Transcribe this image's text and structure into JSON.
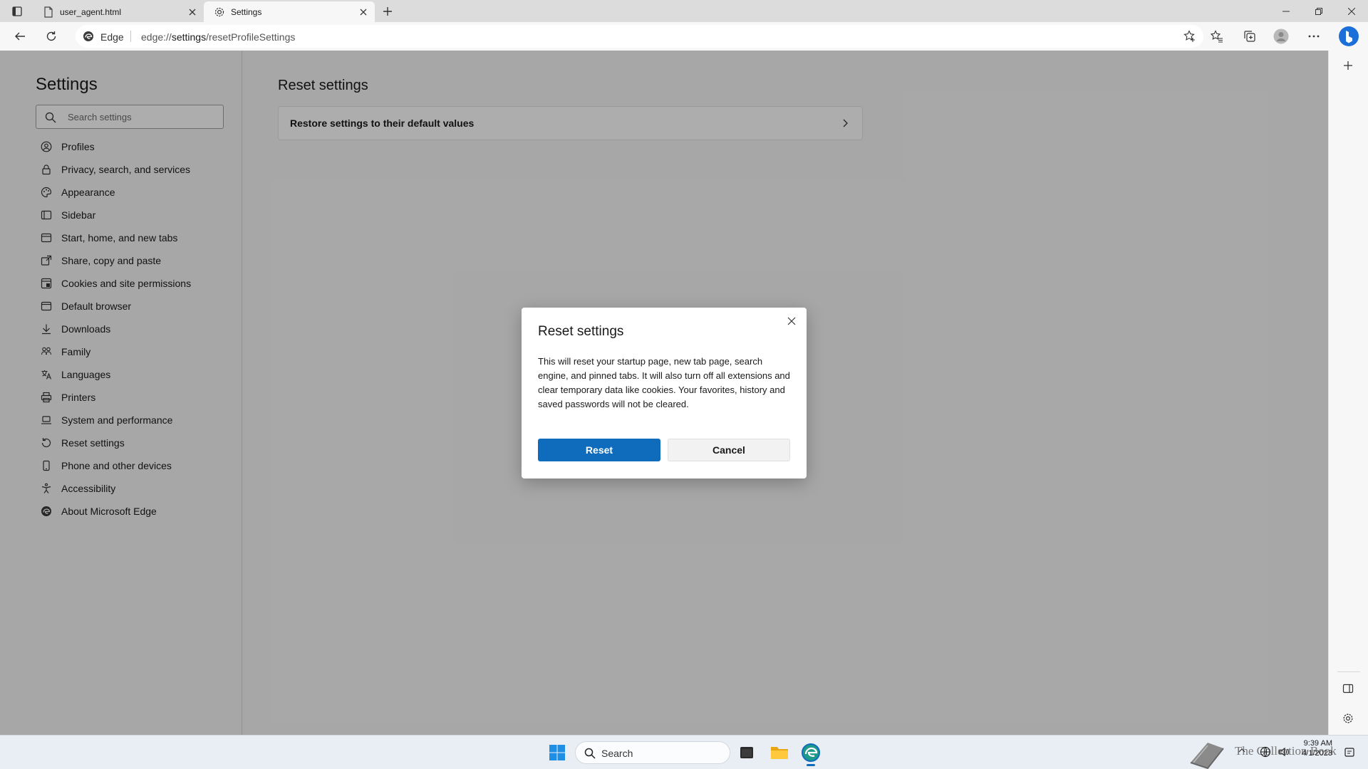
{
  "browser": {
    "tabs": [
      {
        "title": "user_agent.html",
        "icon": "file-icon",
        "active": false
      },
      {
        "title": "Settings",
        "icon": "gear-icon",
        "active": true
      }
    ],
    "address": {
      "identity_label": "Edge",
      "url_prefix": "edge://",
      "url_host": "settings",
      "url_path": "/resetProfileSettings"
    }
  },
  "settings": {
    "title": "Settings",
    "search_placeholder": "Search settings",
    "nav": [
      {
        "label": "Profiles",
        "icon": "profile-icon"
      },
      {
        "label": "Privacy, search, and services",
        "icon": "lock-icon"
      },
      {
        "label": "Appearance",
        "icon": "palette-icon"
      },
      {
        "label": "Sidebar",
        "icon": "sidebar-icon"
      },
      {
        "label": "Start, home, and new tabs",
        "icon": "home-icon"
      },
      {
        "label": "Share, copy and paste",
        "icon": "share-icon"
      },
      {
        "label": "Cookies and site permissions",
        "icon": "cookie-icon"
      },
      {
        "label": "Default browser",
        "icon": "browser-icon"
      },
      {
        "label": "Downloads",
        "icon": "download-icon"
      },
      {
        "label": "Family",
        "icon": "family-icon"
      },
      {
        "label": "Languages",
        "icon": "language-icon"
      },
      {
        "label": "Printers",
        "icon": "printer-icon"
      },
      {
        "label": "System and performance",
        "icon": "laptop-icon"
      },
      {
        "label": "Reset settings",
        "icon": "reset-icon"
      },
      {
        "label": "Phone and other devices",
        "icon": "phone-icon"
      },
      {
        "label": "Accessibility",
        "icon": "accessibility-icon"
      },
      {
        "label": "About Microsoft Edge",
        "icon": "edge-icon"
      }
    ],
    "main": {
      "title": "Reset settings",
      "card_label": "Restore settings to their default values"
    }
  },
  "dialog": {
    "title": "Reset settings",
    "body": "This will reset your startup page, new tab page, search engine, and pinned tabs. It will also turn off all extensions and clear temporary data like cookies. Your favorites, history and saved passwords will not be cleared.",
    "primary_label": "Reset",
    "secondary_label": "Cancel"
  },
  "taskbar": {
    "search_label": "Search",
    "time": "9:39 AM",
    "date": "4/1/2023",
    "watermark": "The Collection Book"
  },
  "colors": {
    "accent": "#0f6cbd",
    "overlay": "rgba(0,0,0,0.32)"
  }
}
